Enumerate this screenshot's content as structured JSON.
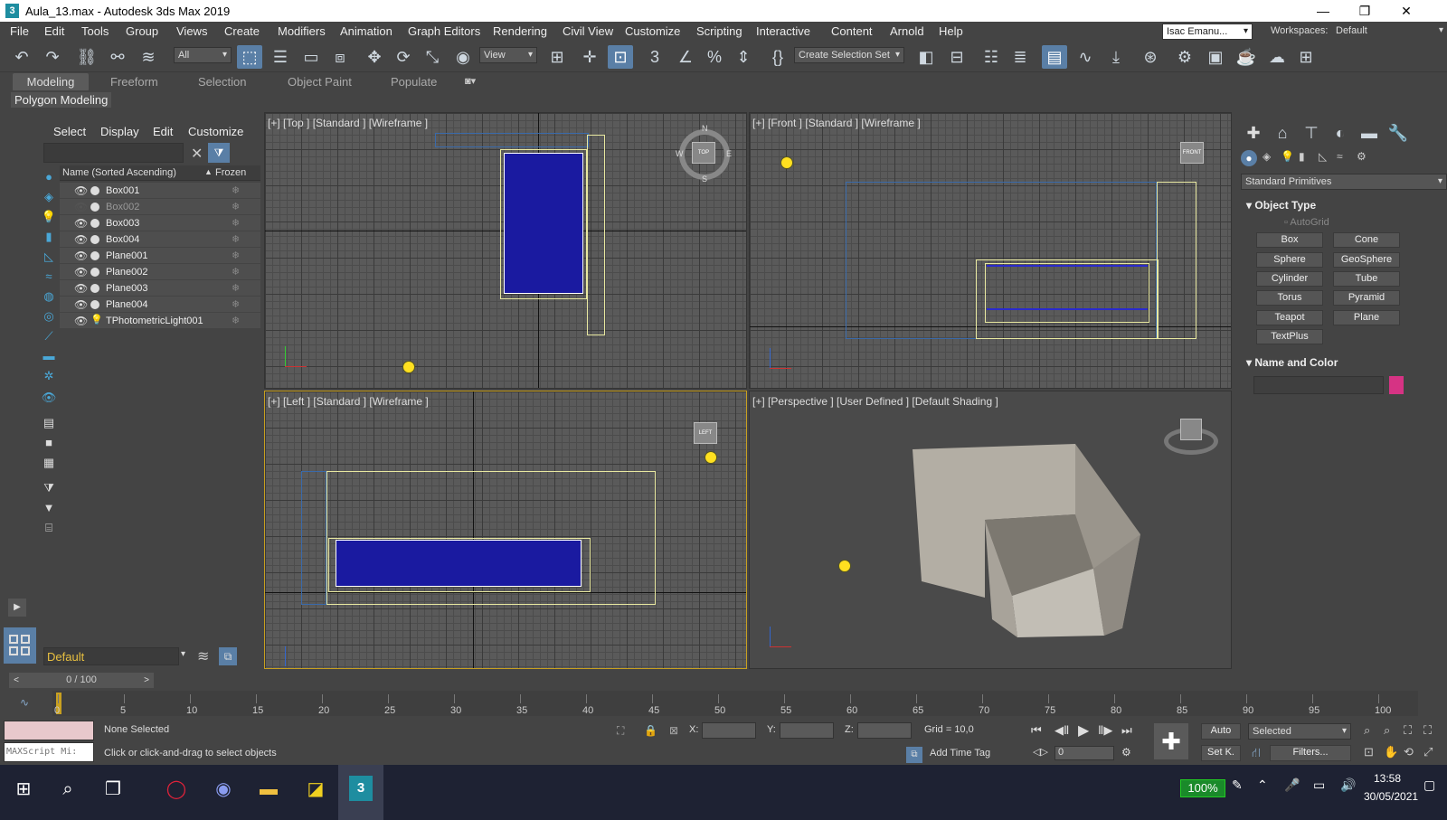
{
  "window": {
    "title": "Aula_13.max - Autodesk 3ds Max 2019",
    "logo": "3",
    "minimize": "—",
    "maximize": "❐",
    "close": "✕"
  },
  "menu": [
    "File",
    "Edit",
    "Tools",
    "Group",
    "Views",
    "Create",
    "Modifiers",
    "Animation",
    "Graph Editors",
    "Rendering",
    "Civil View",
    "Customize",
    "Scripting",
    "Interactive",
    "Content",
    "Arnold",
    "Help"
  ],
  "user": {
    "name": "Isac Emanu...",
    "workspaces_label": "Workspaces:",
    "workspace": "Default"
  },
  "toolbar": {
    "filter": "All",
    "view": "View",
    "selection_set": "Create Selection Set"
  },
  "ribbon": {
    "tabs": [
      "Modeling",
      "Freeform",
      "Selection",
      "Object Paint",
      "Populate"
    ],
    "active": "Modeling",
    "sub": "Polygon Modeling"
  },
  "explorer": {
    "menus": [
      "Select",
      "Display",
      "Edit",
      "Customize"
    ],
    "col_name": "Name (Sorted Ascending)",
    "col_frozen": "Frozen",
    "sort_arrow": "▲",
    "items": [
      {
        "name": "Box001",
        "visible": true
      },
      {
        "name": "Box002",
        "visible": false
      },
      {
        "name": "Box003",
        "visible": true
      },
      {
        "name": "Box004",
        "visible": true
      },
      {
        "name": "Plane001",
        "visible": true
      },
      {
        "name": "Plane002",
        "visible": true
      },
      {
        "name": "Plane003",
        "visible": true
      },
      {
        "name": "Plane004",
        "visible": true
      },
      {
        "name": "TPhotometricLight001",
        "visible": true
      }
    ],
    "layer": "Default"
  },
  "viewports": {
    "top": "[+] [Top ] [Standard ] [Wireframe ]",
    "front": "[+] [Front ] [Standard ] [Wireframe ]",
    "left": "[+] [Left ] [Standard ] [Wireframe ]",
    "perspective": "[+] [Perspective ] [User Defined ] [Default Shading ]",
    "compass": {
      "n": "N",
      "s": "S",
      "e": "E",
      "w": "W",
      "cube": "TOP"
    },
    "cube_front": "FRONT",
    "cube_left": "LEFT"
  },
  "command_panel": {
    "category": "Standard Primitives",
    "object_type": "Object Type",
    "autogrid": "AutoGrid",
    "buttons": [
      "Box",
      "Cone",
      "Sphere",
      "GeoSphere",
      "Cylinder",
      "Tube",
      "Torus",
      "Pyramid",
      "Teapot",
      "Plane",
      "TextPlus"
    ],
    "name_color": "Name and Color",
    "swatch": "#d63384"
  },
  "timeline": {
    "frame": "0 / 100",
    "ticks": [
      "0",
      "5",
      "10",
      "15",
      "20",
      "25",
      "30",
      "35",
      "40",
      "45",
      "50",
      "55",
      "60",
      "65",
      "70",
      "75",
      "80",
      "85",
      "90",
      "95",
      "100"
    ]
  },
  "status": {
    "maxscript": "MAXScript Mi:",
    "selection": "None Selected",
    "prompt": "Click or click-and-drag to select objects",
    "x": "X:",
    "y": "Y:",
    "z": "Z:",
    "grid": "Grid = 10,0",
    "add_time_tag": "Add Time Tag",
    "auto": "Auto",
    "setk": "Set K.",
    "selected": "Selected",
    "frame_input": "0",
    "filters": "Filters..."
  },
  "taskbar": {
    "battery": "100%",
    "time": "13:58",
    "date": "30/05/2021"
  }
}
